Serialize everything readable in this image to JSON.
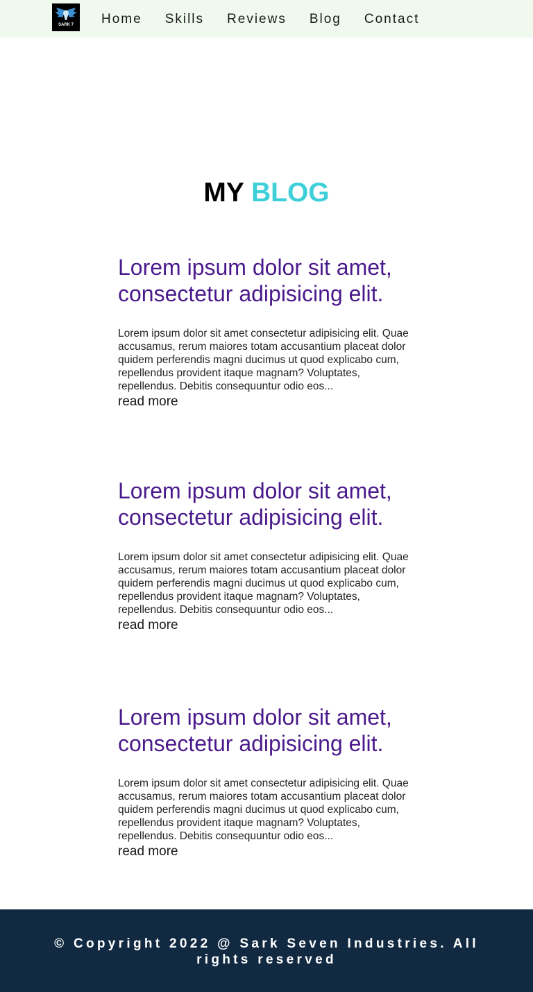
{
  "nav": {
    "logo_text": "SARK 7",
    "links": [
      "Home",
      "Skills",
      "Reviews",
      "Blog",
      "Contact"
    ]
  },
  "blog": {
    "heading_part1": "MY",
    "heading_part2": "BLOG",
    "posts": [
      {
        "title": "Lorem ipsum dolor sit amet, consectetur adipisicing elit.",
        "body": "Lorem ipsum dolor sit amet consectetur adipisicing elit. Quae accusamus, rerum maiores totam accusantium placeat dolor quidem perferendis magni ducimus ut quod explicabo cum, repellendus provident itaque magnam? Voluptates, repellendus. Debitis consequuntur odio eos...",
        "read_more": "read more"
      },
      {
        "title": "Lorem ipsum dolor sit amet, consectetur adipisicing elit.",
        "body": "Lorem ipsum dolor sit amet consectetur adipisicing elit. Quae accusamus, rerum maiores totam accusantium placeat dolor quidem perferendis magni ducimus ut quod explicabo cum, repellendus provident itaque magnam? Voluptates, repellendus. Debitis consequuntur odio eos...",
        "read_more": "read more"
      },
      {
        "title": "Lorem ipsum dolor sit amet, consectetur adipisicing elit.",
        "body": "Lorem ipsum dolor sit amet consectetur adipisicing elit. Quae accusamus, rerum maiores totam accusantium placeat dolor quidem perferendis magni ducimus ut quod explicabo cum, repellendus provident itaque magnam? Voluptates, repellendus. Debitis consequuntur odio eos...",
        "read_more": "read more"
      }
    ]
  },
  "footer": {
    "copyright": "© Copyright 2022 @ Sark Seven Industries. All rights reserved"
  },
  "colors": {
    "nav_bg": "#f0f9ee",
    "accent": "#3ecfd8",
    "post_title": "#4a1a8c",
    "footer_bg": "#112a42"
  }
}
